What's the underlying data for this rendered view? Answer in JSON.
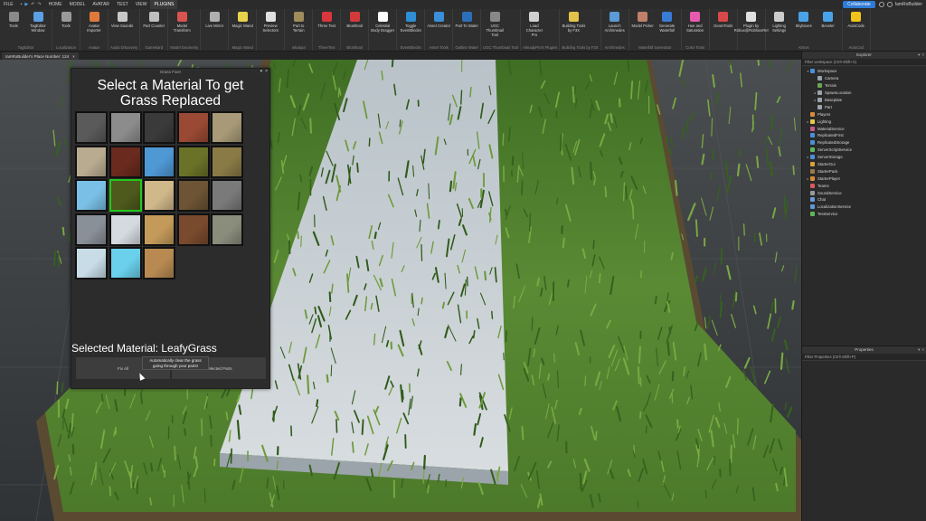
{
  "menubar": {
    "file": "FILE",
    "tabs": [
      "HOME",
      "MODEL",
      "AVATAR",
      "TEST",
      "VIEW",
      "PLUGINS"
    ],
    "active_tab": "PLUGINS",
    "collaborate": "Collaborate",
    "user": "IamRoBuilder"
  },
  "ribbon": {
    "groups": [
      {
        "label": "TagEditor",
        "buttons": [
          {
            "label": "Tools",
            "icon": "wrench-icon",
            "color": "#8a8a8a"
          },
          {
            "label": "TagEditor Window",
            "icon": "tag-icon",
            "color": "#5aa0e6"
          }
        ]
      },
      {
        "label": "Localization",
        "buttons": [
          {
            "label": "Tools",
            "icon": "globe-icon",
            "color": "#9a9a9a"
          }
        ]
      },
      {
        "label": "Avatar",
        "buttons": [
          {
            "label": "Avatar Importer",
            "icon": "avatar-icon",
            "color": "#e07a3c"
          }
        ]
      },
      {
        "label": "Audio Discovery",
        "buttons": [
          {
            "label": "View Sounds",
            "icon": "sound-icon",
            "color": "#c8c8c8"
          }
        ]
      },
      {
        "label": "Gamekard",
        "buttons": [
          {
            "label": "Part Counter",
            "icon": "cube-icon",
            "color": "#bfbfbf"
          }
        ]
      },
      {
        "label": "Model Geometry",
        "buttons": [
          {
            "label": "Model Transform",
            "icon": "transform-icon",
            "color": "#d9534f"
          }
        ]
      },
      {
        "label": "",
        "buttons": [
          {
            "label": "Live Mirror",
            "icon": "mirror-icon",
            "color": "#b0b0b0"
          }
        ]
      },
      {
        "label": "Magic Wand",
        "buttons": [
          {
            "label": "Magic Wand",
            "icon": "wand-icon",
            "color": "#e8d24a"
          }
        ]
      },
      {
        "label": "",
        "buttons": [
          {
            "label": "Preview Selectors",
            "icon": "orb-icon",
            "color": "#e0e0e0"
          }
        ]
      },
      {
        "label": "mkarpia",
        "buttons": [
          {
            "label": "Part to Terrain",
            "icon": "terrain-icon",
            "color": "#a08c5c"
          }
        ]
      },
      {
        "label": "ThreeText",
        "buttons": [
          {
            "label": "Three Text",
            "icon": "three-text-icon",
            "color": "#d9363e"
          }
        ]
      },
      {
        "label": "Brushtool",
        "buttons": [
          {
            "label": "Brushtool",
            "icon": "brush-icon",
            "color": "#d23a3a"
          }
        ]
      },
      {
        "label": "",
        "buttons": [
          {
            "label": "Celestial Body Dragger",
            "icon": "circle-icon",
            "color": "#ffffff"
          }
        ]
      },
      {
        "label": "EventBlocks",
        "buttons": [
          {
            "label": "Toggle EventBlocks",
            "icon": "eventblock-icon",
            "color": "#2d8fd5"
          }
        ]
      },
      {
        "label": "Asset Tools",
        "buttons": [
          {
            "label": "Asset Creator",
            "icon": "asset-icon",
            "color": "#3b8fd9"
          }
        ]
      },
      {
        "label": "Outline Water",
        "buttons": [
          {
            "label": "Part To Water",
            "icon": "water-icon",
            "color": "#2a6fb8"
          }
        ]
      },
      {
        "label": "UGC Thumbnail Tool",
        "buttons": [
          {
            "label": "UGC Thumbnail Tool",
            "icon": "thumbnail-icon",
            "color": "#888888"
          }
        ]
      },
      {
        "label": "AlreadyPro's Plugins",
        "buttons": [
          {
            "label": "Load Character Pro",
            "icon": "character-icon",
            "color": "#d0d0d0"
          }
        ]
      },
      {
        "label": "Building Tools by F3X",
        "buttons": [
          {
            "label": "Building Tools by F3X",
            "icon": "f3x-icon",
            "color": "#e4c34a"
          }
        ]
      },
      {
        "label": "Archimedes",
        "buttons": [
          {
            "label": "Launch Archimedes",
            "icon": "archimedes-icon",
            "color": "#5a9ad6"
          }
        ]
      },
      {
        "label": "Waterfall Generator",
        "buttons": [
          {
            "label": "Model Picker",
            "icon": "picker-icon",
            "color": "#c0806a"
          },
          {
            "label": "Generate Waterfall",
            "icon": "waterfall-icon",
            "color": "#3a7bd5"
          }
        ]
      },
      {
        "label": "Color Tools",
        "buttons": [
          {
            "label": "Hue and Saturation",
            "icon": "color-wheel-icon",
            "color": "#e85ab0"
          }
        ]
      },
      {
        "label": "",
        "buttons": [
          {
            "label": "GeomTools",
            "icon": "geom-icon",
            "color": "#d94848"
          }
        ]
      },
      {
        "label": "",
        "buttons": [
          {
            "label": "Plugin by Robux@RobloxxRel",
            "icon": "plugin-icon",
            "color": "#e0e0e0"
          }
        ]
      },
      {
        "label": "Atmos",
        "buttons": [
          {
            "label": "Lighting Settings",
            "icon": "lighting-icon",
            "color": "#cccccc"
          },
          {
            "label": "Skyboxes",
            "icon": "cloud-icon",
            "color": "#4aa3e8"
          },
          {
            "label": "Beveler",
            "icon": "beveler-icon",
            "color": "#4aa3e8"
          }
        ]
      },
      {
        "label": "AutoCod",
        "buttons": [
          {
            "label": "AutoCode",
            "icon": "autocode-icon",
            "color": "#f0c419"
          }
        ]
      }
    ]
  },
  "document_tab": {
    "label": "IamRoBuilder's Place Number: 124"
  },
  "grass_fixer": {
    "title": "Grass Fixer",
    "heading": "Select a Material To get Grass Replaced",
    "materials": [
      {
        "name": "Slate-rod",
        "color": "#5a5a5a"
      },
      {
        "name": "Concrete",
        "color": "#8c8c8c"
      },
      {
        "name": "Asphalt",
        "color": "#3a3a3a"
      },
      {
        "name": "Brick",
        "color": "#9a4a34"
      },
      {
        "name": "Cobblestone",
        "color": "#a89a78"
      },
      {
        "name": "Sandstone",
        "color": "#b8ab90"
      },
      {
        "name": "CrackedLava",
        "color": "#6a2a1e"
      },
      {
        "name": "Ice",
        "color": "#4e98d4"
      },
      {
        "name": "Grass",
        "color": "#6a7228"
      },
      {
        "name": "Ground",
        "color": "#8a7a46"
      },
      {
        "name": "Glacier",
        "color": "#7ac0e6"
      },
      {
        "name": "LeafyGrass",
        "color": "#4e5a1c"
      },
      {
        "name": "Sand",
        "color": "#d0b88a"
      },
      {
        "name": "Mud",
        "color": "#6c5434"
      },
      {
        "name": "Pavement",
        "color": "#7a7a7a"
      },
      {
        "name": "Rock",
        "color": "#8a9098"
      },
      {
        "name": "Snow",
        "color": "#d4dae0"
      },
      {
        "name": "WoodPlanks",
        "color": "#c49a5a"
      },
      {
        "name": "Wood",
        "color": "#7a4a2e"
      },
      {
        "name": "Basalt",
        "color": "#8a8c7c"
      },
      {
        "name": "Salt",
        "color": "#c8dce8"
      },
      {
        "name": "Glass",
        "color": "#6ad0ec"
      },
      {
        "name": "WoodPlanks2",
        "color": "#b88a52"
      }
    ],
    "selected_index": 11,
    "selected_label": "Selected Material: LeafyGrass",
    "fix_all": "Fix All",
    "fix_selected": "Selected Parts",
    "tooltip": "Automatically clear the grass going through your parts!"
  },
  "explorer": {
    "title": "Explorer",
    "filter_placeholder": "Filter workspace (Ctrl+Shift+X)",
    "items": [
      {
        "label": "Workspace",
        "depth": 0,
        "expand": "▾",
        "color": "#4a90d9"
      },
      {
        "label": "Camera",
        "depth": 1,
        "expand": "",
        "color": "#9aa3ad"
      },
      {
        "label": "Terrain",
        "depth": 1,
        "expand": "",
        "color": "#6aa84f"
      },
      {
        "label": "SpawnLocation",
        "depth": 1,
        "expand": "▸",
        "color": "#9aa3ad"
      },
      {
        "label": "Baseplate",
        "depth": 1,
        "expand": "▸",
        "color": "#9aa3ad"
      },
      {
        "label": "Part",
        "depth": 1,
        "expand": "",
        "color": "#9aa3ad"
      },
      {
        "label": "Players",
        "depth": 0,
        "expand": "",
        "color": "#d98c3a"
      },
      {
        "label": "Lighting",
        "depth": 0,
        "expand": "▸",
        "color": "#e8c84a"
      },
      {
        "label": "MaterialService",
        "depth": 0,
        "expand": "",
        "color": "#c85a8a"
      },
      {
        "label": "ReplicatedFirst",
        "depth": 0,
        "expand": "",
        "color": "#4a90d9"
      },
      {
        "label": "ReplicatedStorage",
        "depth": 0,
        "expand": "",
        "color": "#4a90d9"
      },
      {
        "label": "ServerScriptService",
        "depth": 0,
        "expand": "",
        "color": "#5ab85a"
      },
      {
        "label": "ServerStorage",
        "depth": 0,
        "expand": "▸",
        "color": "#4a90d9"
      },
      {
        "label": "StarterGui",
        "depth": 0,
        "expand": "",
        "color": "#d9a03a"
      },
      {
        "label": "StarterPack",
        "depth": 0,
        "expand": "",
        "color": "#9a7a4a"
      },
      {
        "label": "StarterPlayer",
        "depth": 0,
        "expand": "▸",
        "color": "#d98c3a"
      },
      {
        "label": "Teams",
        "depth": 0,
        "expand": "",
        "color": "#d85a5a"
      },
      {
        "label": "SoundService",
        "depth": 0,
        "expand": "",
        "color": "#9a9a9a"
      },
      {
        "label": "Chat",
        "depth": 0,
        "expand": "",
        "color": "#6a9ad9"
      },
      {
        "label": "LocalizationService",
        "depth": 0,
        "expand": "",
        "color": "#5a9ad9"
      },
      {
        "label": "TestService",
        "depth": 0,
        "expand": "",
        "color": "#5ab85a"
      }
    ]
  },
  "properties": {
    "title": "Properties",
    "filter_placeholder": "Filter Properties (Ctrl+Shift+P)"
  }
}
